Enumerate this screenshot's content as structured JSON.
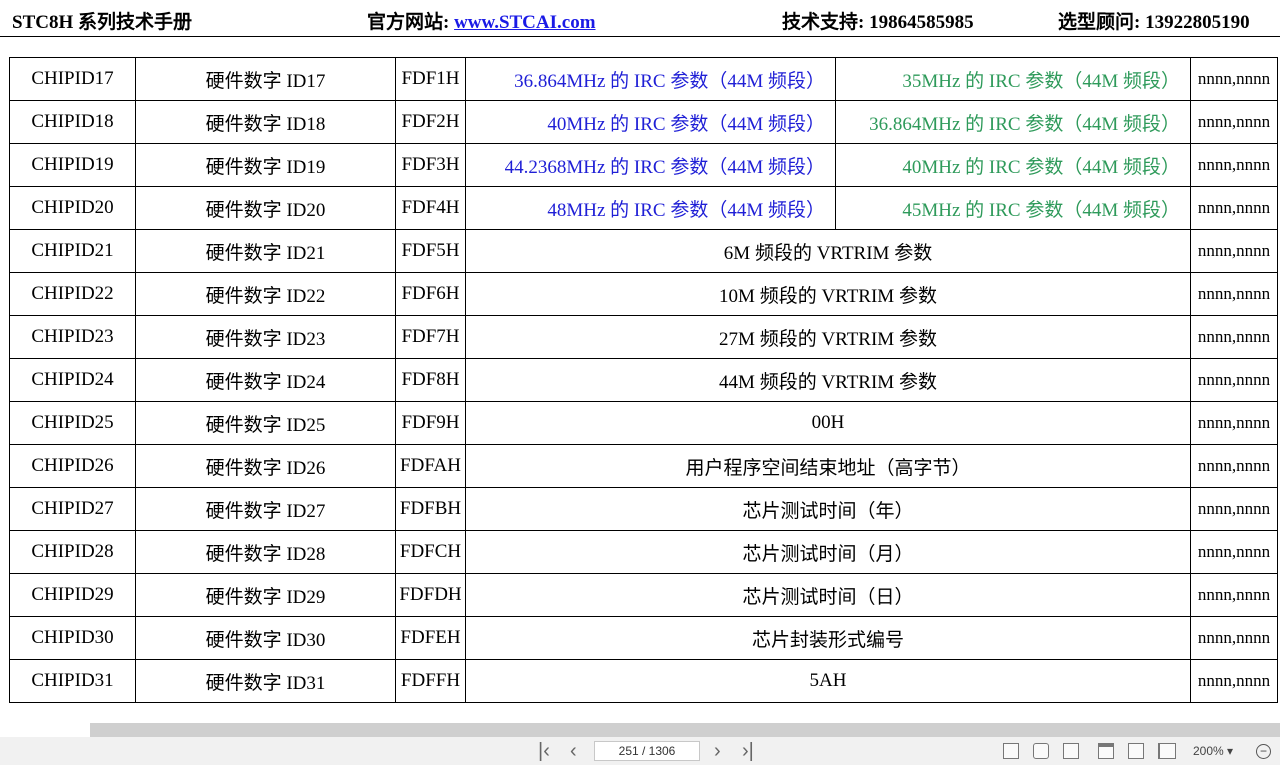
{
  "header": {
    "title": "STC8H 系列技术手册",
    "website_label": "官方网站: ",
    "website": "www.STCAI.com",
    "support": "技术支持: 19864585985",
    "consult": "选型顾问: 13922805190"
  },
  "rows": [
    {
      "sym": "CHIPID17",
      "desc": "硬件数字 ID17",
      "addr": "FDF1H",
      "a": "36.864MHz 的 IRC 参数（44M 频段）",
      "b": "35MHz 的 IRC 参数（44M 频段）",
      "val": "nnnn,nnnn"
    },
    {
      "sym": "CHIPID18",
      "desc": "硬件数字 ID18",
      "addr": "FDF2H",
      "a": "40MHz 的 IRC 参数（44M 频段）",
      "b": "36.864MHz 的 IRC 参数（44M 频段）",
      "val": "nnnn,nnnn"
    },
    {
      "sym": "CHIPID19",
      "desc": "硬件数字 ID19",
      "addr": "FDF3H",
      "a": "44.2368MHz 的 IRC 参数（44M 频段）",
      "b": "40MHz 的 IRC 参数（44M 频段）",
      "val": "nnnn,nnnn"
    },
    {
      "sym": "CHIPID20",
      "desc": "硬件数字 ID20",
      "addr": "FDF4H",
      "a": "48MHz 的 IRC 参数（44M 频段）",
      "b": "45MHz 的 IRC 参数（44M 频段）",
      "val": "nnnn,nnnn"
    },
    {
      "sym": "CHIPID21",
      "desc": "硬件数字 ID21",
      "addr": "FDF5H",
      "merged": "6M 频段的 VRTRIM 参数",
      "val": "nnnn,nnnn"
    },
    {
      "sym": "CHIPID22",
      "desc": "硬件数字 ID22",
      "addr": "FDF6H",
      "merged": "10M 频段的 VRTRIM 参数",
      "val": "nnnn,nnnn"
    },
    {
      "sym": "CHIPID23",
      "desc": "硬件数字 ID23",
      "addr": "FDF7H",
      "merged": "27M 频段的 VRTRIM 参数",
      "val": "nnnn,nnnn"
    },
    {
      "sym": "CHIPID24",
      "desc": "硬件数字 ID24",
      "addr": "FDF8H",
      "merged": "44M 频段的 VRTRIM 参数",
      "val": "nnnn,nnnn"
    },
    {
      "sym": "CHIPID25",
      "desc": "硬件数字 ID25",
      "addr": "FDF9H",
      "merged": "00H",
      "val": "nnnn,nnnn"
    },
    {
      "sym": "CHIPID26",
      "desc": "硬件数字 ID26",
      "addr": "FDFAH",
      "merged": "用户程序空间结束地址（高字节）",
      "val": "nnnn,nnnn"
    },
    {
      "sym": "CHIPID27",
      "desc": "硬件数字 ID27",
      "addr": "FDFBH",
      "merged": "芯片测试时间（年）",
      "val": "nnnn,nnnn"
    },
    {
      "sym": "CHIPID28",
      "desc": "硬件数字 ID28",
      "addr": "FDFCH",
      "merged": "芯片测试时间（月）",
      "val": "nnnn,nnnn"
    },
    {
      "sym": "CHIPID29",
      "desc": "硬件数字 ID29",
      "addr": "FDFDH",
      "merged": "芯片测试时间（日）",
      "val": "nnnn,nnnn"
    },
    {
      "sym": "CHIPID30",
      "desc": "硬件数字 ID30",
      "addr": "FDFEH",
      "merged": "芯片封装形式编号",
      "val": "nnnn,nnnn"
    },
    {
      "sym": "CHIPID31",
      "desc": "硬件数字 ID31",
      "addr": "FDFFH",
      "merged": "5AH",
      "val": "nnnn,nnnn"
    }
  ],
  "colors": {
    "irc_primary": "#1f1fd6",
    "irc_secondary": "#2e9a5a"
  },
  "toolbar": {
    "page_indicator": "251 / 1306",
    "zoom": "200%",
    "icons": [
      "first-page-icon",
      "prev-page-icon",
      "next-page-icon",
      "last-page-icon",
      "fit-page-icon",
      "rotate-icon",
      "fit-width-icon",
      "single-page-icon",
      "continuous-page-icon",
      "two-page-icon",
      "zoom-out-icon"
    ]
  }
}
